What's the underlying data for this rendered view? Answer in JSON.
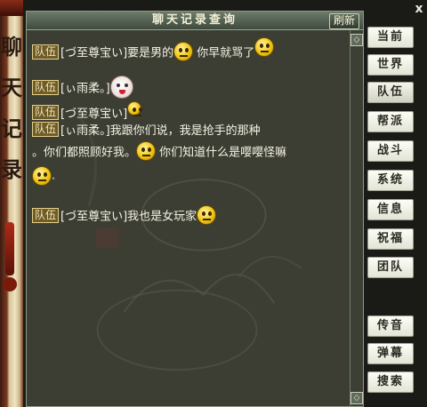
{
  "scroll_text": [
    "聊",
    "天",
    "记",
    "录"
  ],
  "window": {
    "title": "聊天记录查询",
    "refresh_label": "刷新",
    "close_label": "x"
  },
  "messages": [
    {
      "channel": "队伍",
      "text": "[づ至尊宝い]要是男的",
      "after": " 你早就骂了",
      "emotes": [
        "smiley",
        "smiley"
      ]
    },
    {
      "channel": "队伍",
      "text": "[ぃ雨柔。]",
      "emotes": [
        "white-face"
      ]
    },
    {
      "channel": "队伍",
      "text": "[づ至尊宝い]",
      "emotes": [
        "smiley"
      ]
    },
    {
      "channel": "队伍",
      "text": "[ぃ雨柔。]我跟你们说，我是抢手的那种",
      "cont1": "。你们都照顾好我。",
      "cont1b": " 你们知道什么是嘤嘤怪嘛",
      "cont2": ".",
      "emotes": [
        "smiley",
        "smiley"
      ]
    },
    {
      "channel": "队伍",
      "text": "[づ至尊宝い]我也是女玩家",
      "emotes": [
        "smiley"
      ]
    }
  ],
  "channel_buttons": [
    "当前",
    "世界",
    "队伍",
    "帮派",
    "战斗",
    "系统",
    "信息",
    "祝福",
    "团队"
  ],
  "active_channel": "队伍",
  "tool_buttons": [
    "传音",
    "弹幕",
    "搜索"
  ]
}
